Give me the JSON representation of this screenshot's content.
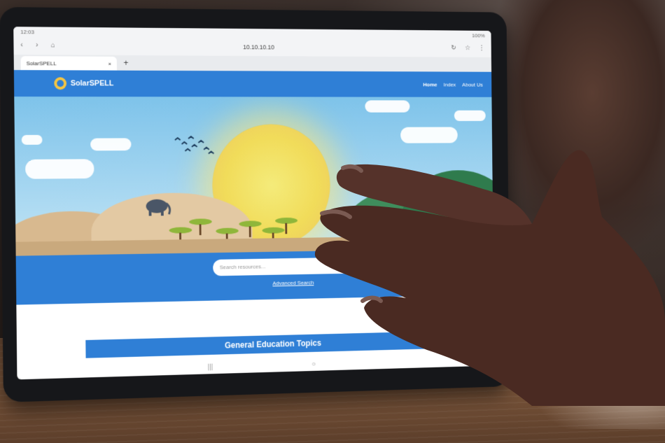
{
  "status_bar": {
    "time": "12:03",
    "battery": "100%"
  },
  "browser": {
    "url": "10.10.10.10",
    "tab_title": "SolarSPELL",
    "tab_close": "×",
    "new_tab": "+"
  },
  "site": {
    "logo_text": "SolarSPELL",
    "nav": [
      "Home",
      "Index",
      "About Us"
    ],
    "search_placeholder": "Search resources...",
    "advanced_search": "Advanced Search",
    "section_title": "General Education Topics"
  },
  "colors": {
    "brand_blue": "#2f7fd6",
    "sky": "#a7d7f1",
    "sun": "#f1dc5a"
  }
}
